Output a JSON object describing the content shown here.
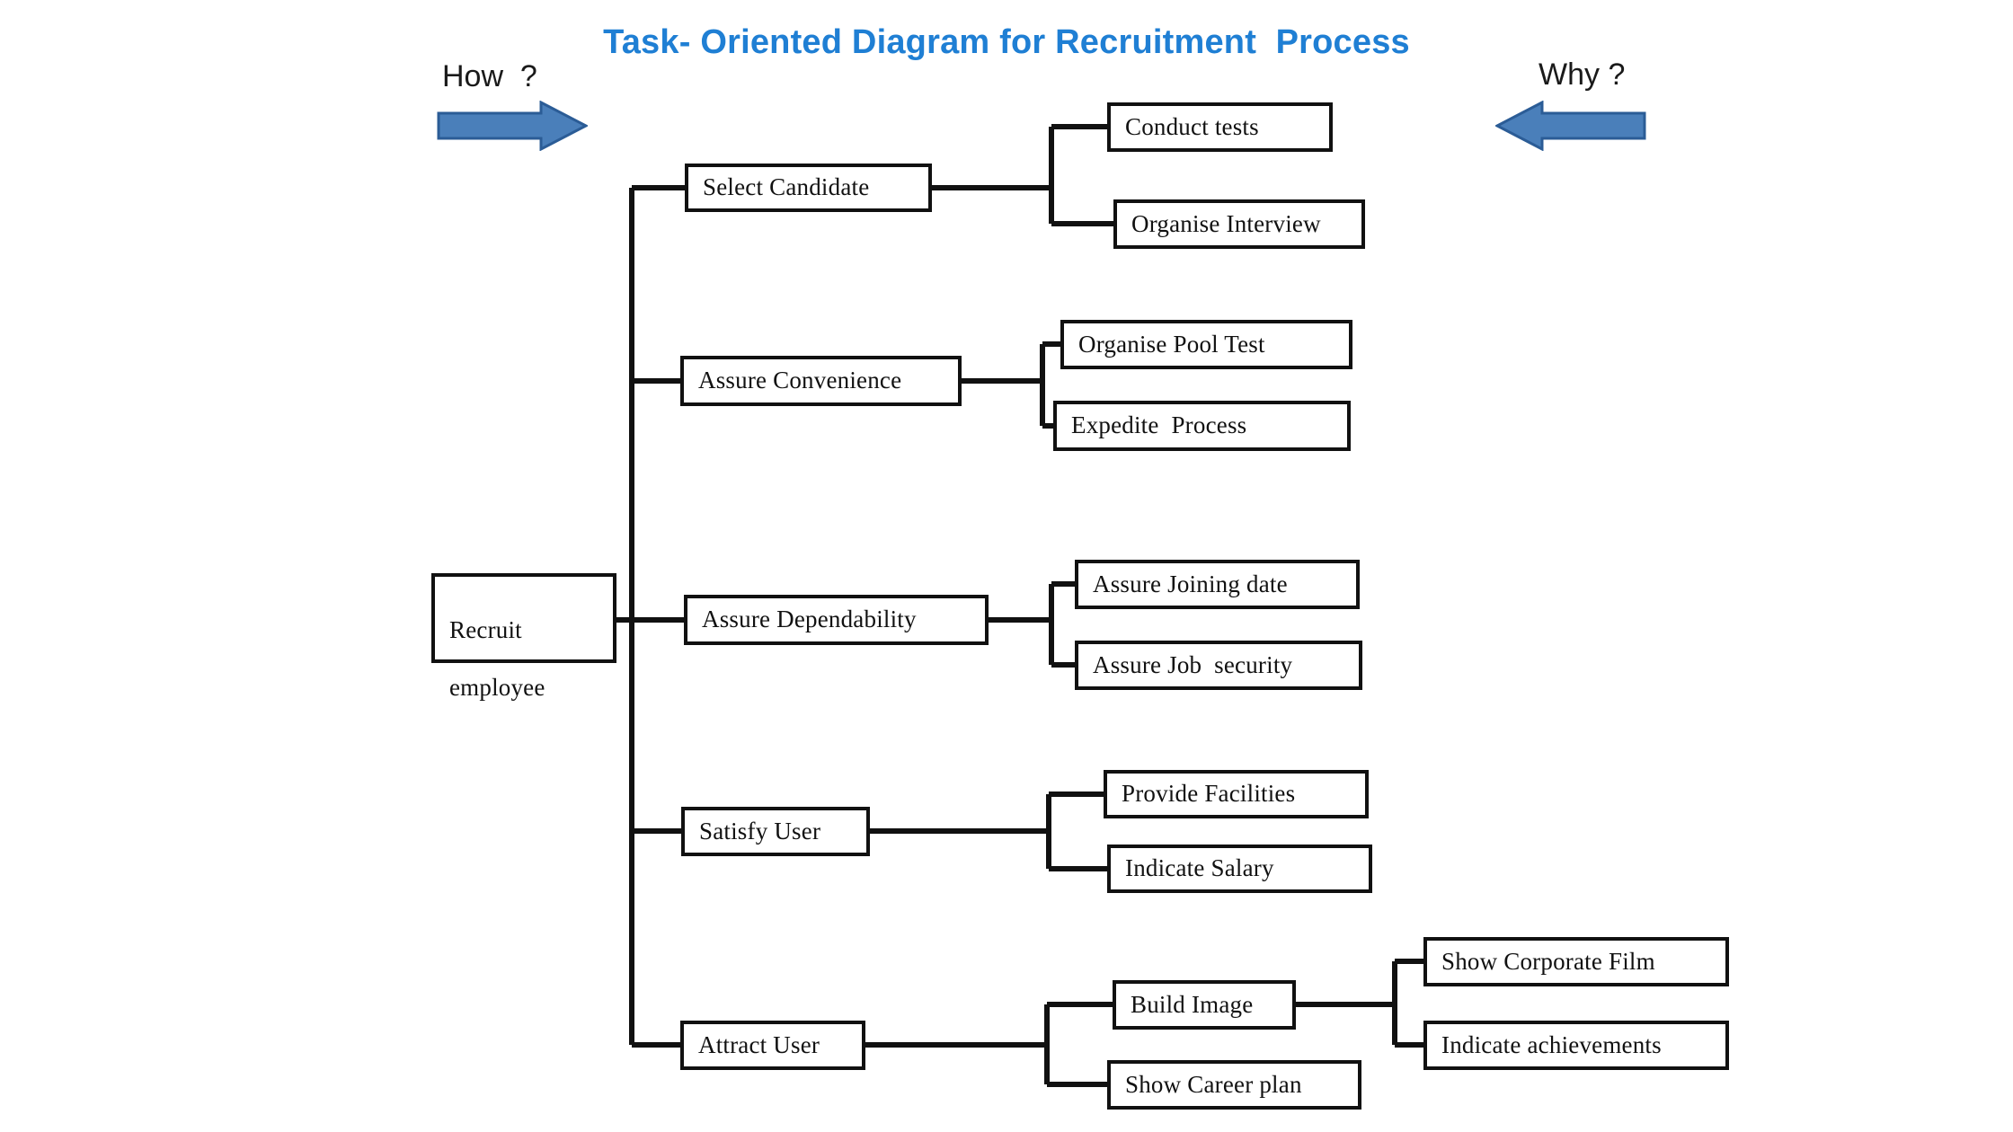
{
  "title": "Task- Oriented Diagram for Recruitment  Process",
  "accent_color": "#1f7fd4",
  "arrow_fill": "#4a7fba",
  "arrow_stroke": "#2b5c96",
  "node_border_color": "#111111",
  "direction_labels": {
    "left": "How  ?",
    "right": "Why ?",
    "left_arrow_icon": "arrow-right-icon",
    "right_arrow_icon": "arrow-left-icon"
  },
  "root": {
    "line1": "Recruit",
    "line2": "employee"
  },
  "branches": [
    {
      "label": "Select Candidate",
      "children": [
        {
          "label": "Conduct tests",
          "children": []
        },
        {
          "label": "Organise Interview",
          "children": []
        }
      ]
    },
    {
      "label": "Assure Convenience",
      "children": [
        {
          "label": "Organise Pool Test",
          "children": []
        },
        {
          "label": "Expedite  Process",
          "children": []
        }
      ]
    },
    {
      "label": "Assure Dependability",
      "children": [
        {
          "label": "Assure Joining date",
          "children": []
        },
        {
          "label": "Assure Job  security",
          "children": []
        }
      ]
    },
    {
      "label": "Satisfy User",
      "children": [
        {
          "label": "Provide Facilities",
          "children": []
        },
        {
          "label": "Indicate Salary",
          "children": []
        }
      ]
    },
    {
      "label": "Attract User",
      "children": [
        {
          "label": "Build Image",
          "children": [
            {
              "label": "Show Corporate Film",
              "children": []
            },
            {
              "label": "Indicate achievements",
              "children": []
            }
          ]
        },
        {
          "label": "Show Career plan",
          "children": []
        }
      ]
    }
  ]
}
